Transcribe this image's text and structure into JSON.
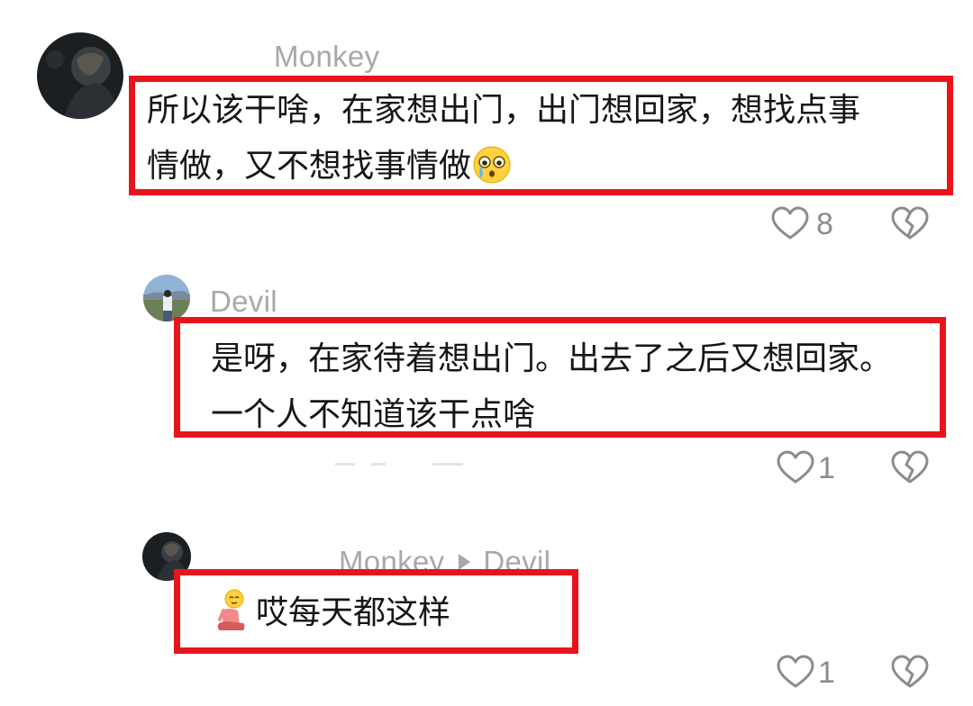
{
  "comments": [
    {
      "author": "Monkey",
      "lines": [
        "所以该干啥，在家想出门，出门想回家，想找点事",
        "情做，又不想找事情做"
      ],
      "trailing_emoji": "crying-face-emoji",
      "likes": "8",
      "icons": {
        "like": "heart-outline-icon",
        "dislike": "broken-heart-icon"
      }
    },
    {
      "author": "Devil",
      "lines": [
        "是呀，在家待着想出门。出去了之后又想回家。",
        "一个人不知道该干点啥"
      ],
      "likes": "1",
      "icons": {
        "like": "heart-outline-icon",
        "dislike": "broken-heart-icon"
      }
    },
    {
      "author": "Monkey",
      "reply_to": "Devil",
      "leading_emoji": "sitting-person-emoji",
      "text": "哎每天都这样",
      "likes": "1",
      "icons": {
        "like": "heart-outline-icon",
        "dislike": "broken-heart-icon"
      }
    }
  ],
  "colors": {
    "highlight_border": "#e8141c",
    "username": "#a8a8a8",
    "text": "#161616",
    "icon": "#8c8c8c"
  }
}
